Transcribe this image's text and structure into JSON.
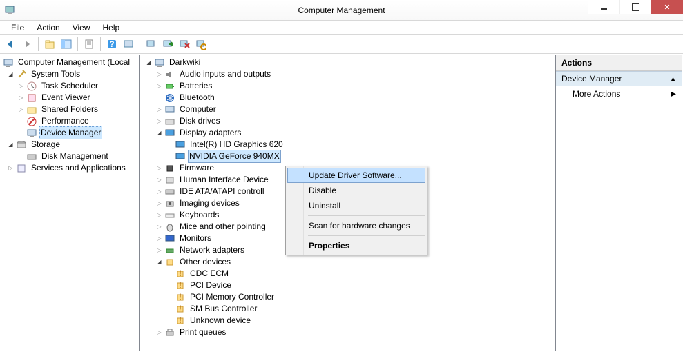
{
  "window": {
    "title": "Computer Management"
  },
  "menu": {
    "file": "File",
    "action": "Action",
    "view": "View",
    "help": "Help"
  },
  "left_tree": {
    "root": "Computer Management (Local",
    "system_tools": "System Tools",
    "task_scheduler": "Task Scheduler",
    "event_viewer": "Event Viewer",
    "shared_folders": "Shared Folders",
    "performance": "Performance",
    "device_manager": "Device Manager",
    "storage": "Storage",
    "disk_management": "Disk Management",
    "services_apps": "Services and Applications"
  },
  "mid_tree": {
    "root": "Darkwiki",
    "audio": "Audio inputs and outputs",
    "batteries": "Batteries",
    "bluetooth": "Bluetooth",
    "computer": "Computer",
    "disk_drives": "Disk drives",
    "display_adapters": "Display adapters",
    "intel_hd": "Intel(R) HD Graphics 620",
    "nvidia": "NVIDIA GeForce 940MX",
    "firmware": "Firmware",
    "hid": "Human Interface Device",
    "ide": "IDE ATA/ATAPI controll",
    "imaging": "Imaging devices",
    "keyboards": "Keyboards",
    "mice": "Mice and other pointing",
    "monitors": "Monitors",
    "network": "Network adapters",
    "other": "Other devices",
    "cdc_ecm": "CDC ECM",
    "pci_device": "PCI Device",
    "pci_mem": "PCI Memory Controller",
    "sm_bus": "SM Bus Controller",
    "unknown": "Unknown device",
    "print_queues": "Print queues"
  },
  "context_menu": {
    "update": "Update Driver Software...",
    "disable": "Disable",
    "uninstall": "Uninstall",
    "scan": "Scan for hardware changes",
    "properties": "Properties"
  },
  "actions": {
    "header": "Actions",
    "section": "Device Manager",
    "more": "More Actions"
  }
}
